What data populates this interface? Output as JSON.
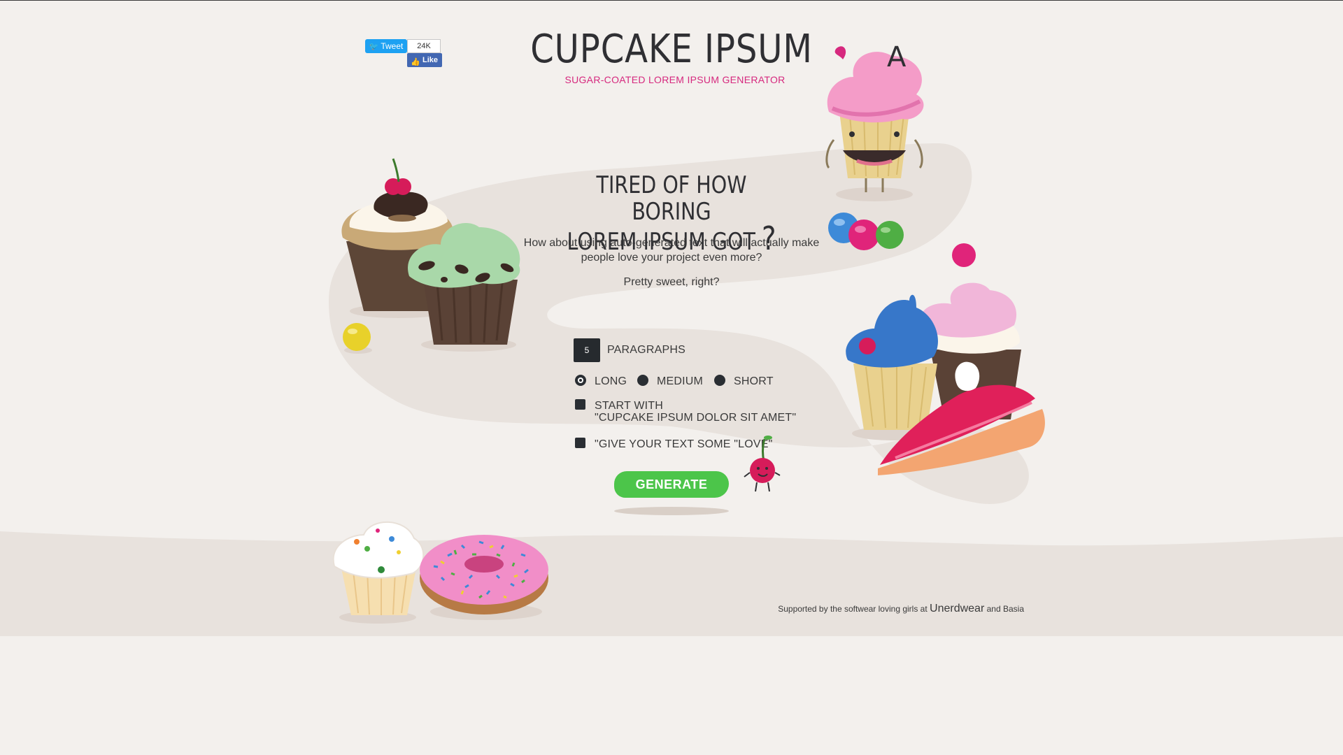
{
  "social": {
    "tweet_label": "Tweet",
    "tweet_count": "24K",
    "like_label": "Like"
  },
  "header": {
    "title": "CUPCAKE IPSUM",
    "subtitle": "SUGAR-COATED LOREM IPSUM GENERATOR"
  },
  "intro": {
    "headline_line1": "TIRED OF HOW BORING",
    "headline_line2": "LOREM IPSUM GOT",
    "headline_mark": "?",
    "lead": "How about using auto-generated text that will actually make people love your project even more?",
    "sweet": "Pretty sweet, right?"
  },
  "form": {
    "paragraphs_value": "5",
    "paragraphs_label": "PARAGRAPHS",
    "length_options": [
      {
        "label": "LONG",
        "selected": true
      },
      {
        "label": "MEDIUM",
        "selected": false
      },
      {
        "label": "SHORT",
        "selected": false
      }
    ],
    "start_with_line1": "START WITH",
    "start_with_line2": "\"CUPCAKE IPSUM DOLOR SIT AMET\"",
    "love_label": "\"GIVE YOUR TEXT SOME \"LOVE\"",
    "generate_label": "GENERATE"
  },
  "footer": {
    "prefix": "Supported by the softwear loving girls at",
    "brand": "Unerdwear",
    "suffix": "and Basia"
  },
  "colors": {
    "background": "#f3f0ed",
    "accent_pink": "#d6287e",
    "generate_green": "#4cc54a",
    "dark": "#2a2e33"
  },
  "icons": [
    "twitter-bird-icon",
    "facebook-thumb-icon"
  ]
}
